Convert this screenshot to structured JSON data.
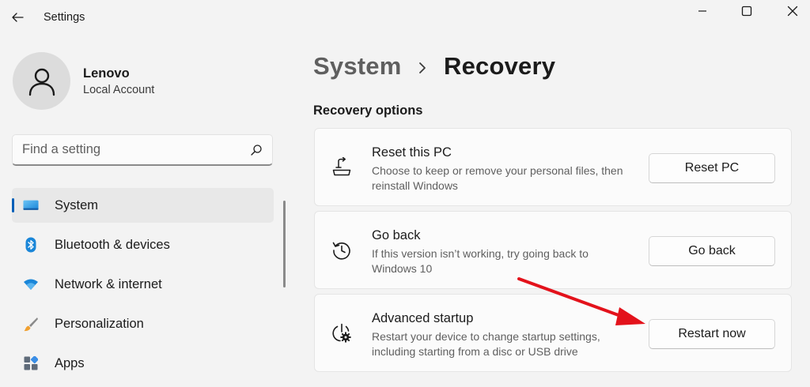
{
  "window": {
    "title": "Settings",
    "controls": {
      "minimize": "minimize-icon",
      "maximize": "maximize-icon",
      "close": "close-icon"
    }
  },
  "profile": {
    "name": "Lenovo",
    "account_type": "Local Account",
    "avatar_icon": "person-icon"
  },
  "search": {
    "placeholder": "Find a setting",
    "value": "",
    "icon": "search-icon"
  },
  "sidebar": {
    "items": [
      {
        "label": "System",
        "icon": "monitor-icon",
        "active": true
      },
      {
        "label": "Bluetooth & devices",
        "icon": "bluetooth-icon",
        "active": false
      },
      {
        "label": "Network & internet",
        "icon": "wifi-icon",
        "active": false
      },
      {
        "label": "Personalization",
        "icon": "brush-icon",
        "active": false
      },
      {
        "label": "Apps",
        "icon": "apps-icon",
        "active": false
      }
    ]
  },
  "breadcrumb": {
    "parent": "System",
    "separator_icon": "chevron-right-icon",
    "current": "Recovery"
  },
  "section": {
    "heading": "Recovery options"
  },
  "cards": [
    {
      "title": "Reset this PC",
      "description": "Choose to keep or remove your personal files, then reinstall Windows",
      "button_label": "Reset PC",
      "icon": "reset-pc-icon"
    },
    {
      "title": "Go back",
      "description": "If this version isn’t working, try going back to Windows 10",
      "button_label": "Go back",
      "icon": "history-icon"
    },
    {
      "title": "Advanced startup",
      "description": "Restart your device to change startup settings, including starting from a disc or USB drive",
      "button_label": "Restart now",
      "icon": "power-settings-icon"
    }
  ],
  "annotation": {
    "arrow_color": "#e3121b",
    "target": "Restart now"
  },
  "colors": {
    "accent": "#005fb8",
    "background": "#f3f3f3",
    "card_background": "#fbfbfb"
  }
}
